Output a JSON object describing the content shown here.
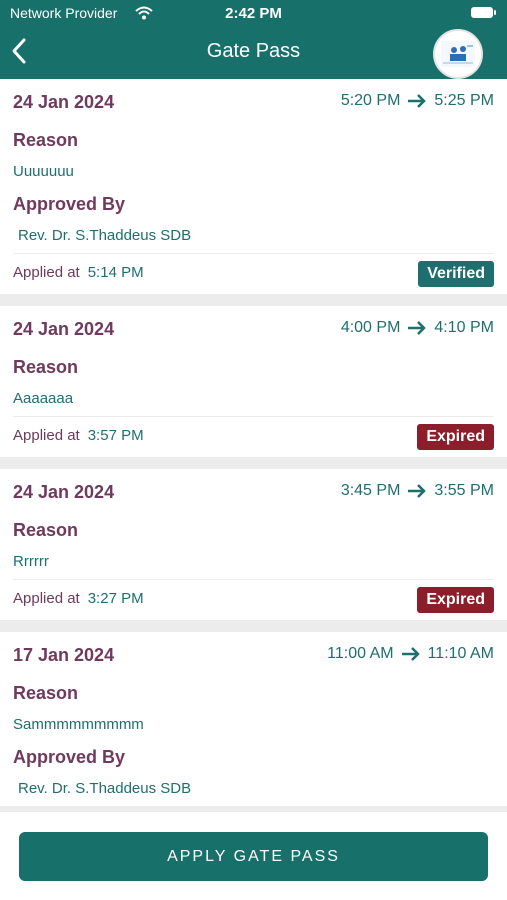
{
  "status_bar": {
    "carrier": "Network Provider",
    "time": "2:42 PM"
  },
  "header": {
    "title": "Gate Pass"
  },
  "labels": {
    "reason": "Reason",
    "approved_by": "Approved By",
    "applied_at": "Applied at"
  },
  "passes": [
    {
      "date": "24 Jan 2024",
      "from": "5:20 PM",
      "to": "5:25 PM",
      "reason": "Uuuuuuu",
      "approved_by": "Rev. Dr. S.Thaddeus SDB",
      "applied_time": "5:14 PM",
      "status": "Verified"
    },
    {
      "date": "24 Jan 2024",
      "from": "4:00 PM",
      "to": "4:10 PM",
      "reason": "Aaaaaaa",
      "applied_time": "3:57 PM",
      "status": "Expired"
    },
    {
      "date": "24 Jan 2024",
      "from": "3:45 PM",
      "to": "3:55 PM",
      "reason": "Rrrrrr",
      "applied_time": "3:27 PM",
      "status": "Expired"
    },
    {
      "date": "17 Jan 2024",
      "from": "11:00 AM",
      "to": "11:10 AM",
      "reason": "Sammmmmmmmm",
      "approved_by": "Rev. Dr. S.Thaddeus SDB"
    }
  ],
  "footer": {
    "apply_label": "APPLY GATE PASS"
  },
  "colors": {
    "primary": "#18706a",
    "expired": "#8b1e2a",
    "accent_text": "#6f3a5d"
  }
}
